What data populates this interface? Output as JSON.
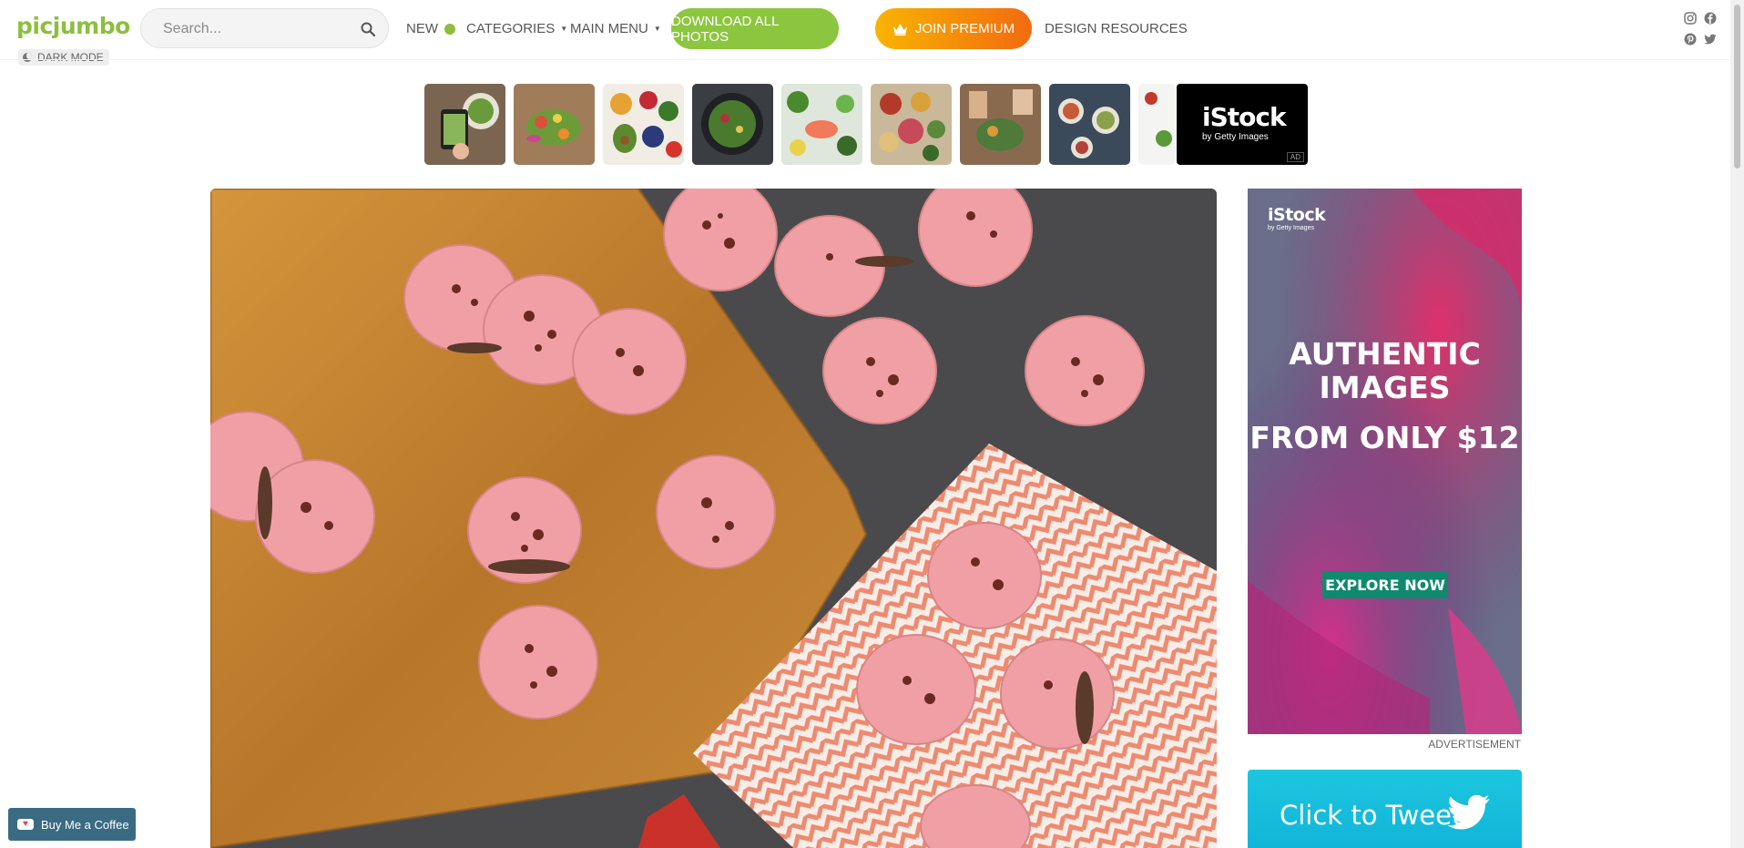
{
  "header": {
    "logo": "picjumbo",
    "dark_mode_label": "DARK MODE",
    "search_placeholder": "Search...",
    "nav": {
      "new_label": "NEW",
      "categories_label": "CATEGORIES",
      "main_menu_label": "MAIN MENU",
      "design_resources_label": "DESIGN RESOURCES"
    },
    "download_label": "DOWNLOAD ALL PHOTOS",
    "premium_label": "JOIN PREMIUM",
    "social_icons": [
      "instagram-icon",
      "facebook-icon",
      "pinterest-icon",
      "twitter-icon"
    ]
  },
  "thumbnails": {
    "items": [
      "salad-phone-photo",
      "vegetables-board-photo",
      "fruit-veg-mix-photo",
      "salad-bowl-photo",
      "salmon-vegetables-photo",
      "healthy-food-bowls-photo",
      "table-dining-photo",
      "feast-table-photo",
      "partial-food-photo"
    ],
    "ad": {
      "brand": "iStock",
      "sub": "by Getty Images",
      "ad_mark": "AD"
    }
  },
  "main_photo": {
    "subject": "pink macarons on wooden board"
  },
  "sidebar": {
    "ad": {
      "brand": "iStock",
      "brand_sub": "by Getty Images",
      "line1": "AUTHENTIC IMAGES",
      "line2": "FROM ONLY $12",
      "cta": "EXPLORE NOW"
    },
    "ad_label": "ADVERTISEMENT",
    "tweet_label": "Click to Tweet"
  },
  "coffee_label": "Buy Me a Coffee",
  "colors": {
    "brand_green": "#8cbf3f",
    "premium_start": "#f8b400",
    "premium_end": "#f26a10",
    "tweet_blue": "#1cc6df",
    "ad_cta": "#0f8a6e"
  }
}
